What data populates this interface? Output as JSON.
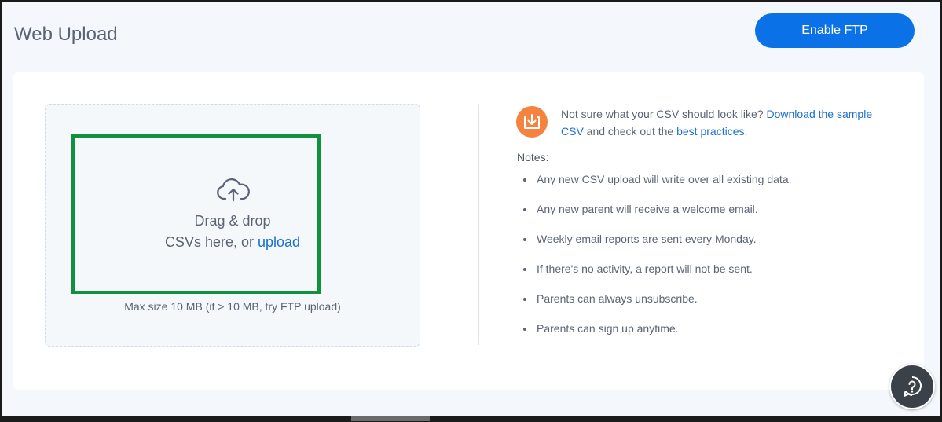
{
  "header": {
    "title": "Web Upload",
    "enable_ftp_label": "Enable FTP"
  },
  "dropzone": {
    "line1": "Drag & drop",
    "line2_prefix": "CSVs here, or ",
    "upload_link": "upload",
    "max_size": "Max size 10 MB (if > 10 MB, try FTP upload)",
    "icon": "cloud-upload-icon"
  },
  "info": {
    "icon": "download-icon",
    "text_prefix": "Not sure what your CSV should look like? ",
    "sample_link": "Download the sample CSV",
    "text_middle": " and check out the ",
    "best_practices_link": "best practices",
    "text_suffix": "."
  },
  "notes": {
    "title": "Notes:",
    "items": [
      "Any new CSV upload will write over all existing data.",
      "Any new parent will receive a welcome email.",
      "Weekly email reports are sent every Monday.",
      "If there's no activity, a report will not be sent.",
      "Parents can always unsubscribe.",
      "Parents can sign up anytime."
    ]
  },
  "help": {
    "icon": "help-question-icon"
  },
  "colors": {
    "accent": "#0a72e6",
    "highlight_border": "#11913f",
    "info_icon_bg": "#f3833e",
    "link": "#1a6fd1",
    "text": "#5a6475",
    "help_bg": "#3a4149"
  }
}
